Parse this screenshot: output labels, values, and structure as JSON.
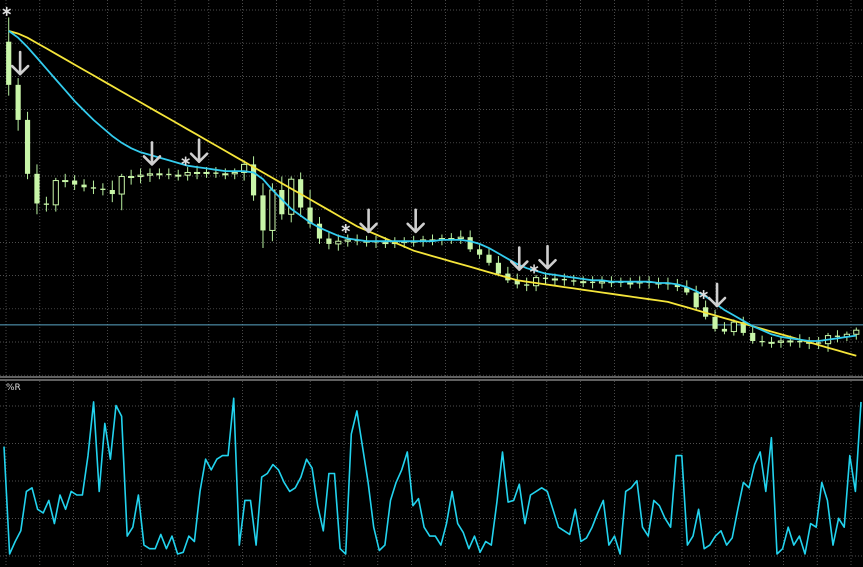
{
  "indicator_label": "%R",
  "colors": {
    "background": "#000000",
    "grid": "#c0c0c0",
    "frame": "#bfbfbf",
    "bull_candle": "#c8f5a8",
    "bear_candle": "#c8f5a8",
    "wick": "#b8f0a0",
    "ma_fast": "#33ccee",
    "ma_slow": "#f5e53a",
    "arrow": "#cfcfcf",
    "star": "#dddddd",
    "hline": "#5aa7c7",
    "wpr_line": "#22d3ee"
  },
  "chart_data": [
    {
      "type": "candlestick",
      "series": [
        {
          "name": "",
          "role": "price"
        },
        {
          "name": "",
          "role": "moving-average-fast"
        },
        {
          "name": "",
          "role": "moving-average-slow"
        }
      ],
      "candles": [
        {
          "o": 9.0,
          "h": 10.8,
          "l": 5.0,
          "c": 5.8
        },
        {
          "o": 5.8,
          "h": 6.3,
          "l": 2.4,
          "c": 3.2
        },
        {
          "o": 3.2,
          "h": 3.8,
          "l": -1.2,
          "c": -0.8
        },
        {
          "o": -0.8,
          "h": -0.1,
          "l": -3.8,
          "c": -3.0
        },
        {
          "o": -3.0,
          "h": -2.5,
          "l": -3.6,
          "c": -3.1
        },
        {
          "o": -3.1,
          "h": -1.1,
          "l": -3.6,
          "c": -1.3
        },
        {
          "o": -1.3,
          "h": -0.8,
          "l": -1.8,
          "c": -1.3
        },
        {
          "o": -1.3,
          "h": -0.9,
          "l": -2.0,
          "c": -1.6
        },
        {
          "o": -1.6,
          "h": -1.2,
          "l": -2.1,
          "c": -1.8
        },
        {
          "o": -1.8,
          "h": -1.3,
          "l": -2.3,
          "c": -1.9
        },
        {
          "o": -1.9,
          "h": -1.5,
          "l": -2.4,
          "c": -2.0
        },
        {
          "o": -2.0,
          "h": -1.3,
          "l": -2.9,
          "c": -2.3
        },
        {
          "o": -2.3,
          "h": -0.8,
          "l": -3.5,
          "c": -1.0
        },
        {
          "o": -1.0,
          "h": -0.5,
          "l": -1.6,
          "c": -1.0
        },
        {
          "o": -1.0,
          "h": -0.4,
          "l": -1.5,
          "c": -0.9
        },
        {
          "o": -0.9,
          "h": -0.4,
          "l": -1.4,
          "c": -0.8
        },
        {
          "o": -0.8,
          "h": -0.4,
          "l": -1.2,
          "c": -0.8
        },
        {
          "o": -0.8,
          "h": -0.4,
          "l": -1.2,
          "c": -0.9
        },
        {
          "o": -0.9,
          "h": -0.5,
          "l": -1.3,
          "c": -0.9
        },
        {
          "o": -0.9,
          "h": -0.3,
          "l": -1.3,
          "c": -0.7
        },
        {
          "o": -0.7,
          "h": -0.2,
          "l": -1.2,
          "c": -0.7
        },
        {
          "o": -0.7,
          "h": -0.3,
          "l": -1.1,
          "c": -0.7
        },
        {
          "o": -0.7,
          "h": -0.3,
          "l": -1.1,
          "c": -0.8
        },
        {
          "o": -0.8,
          "h": -0.4,
          "l": -1.2,
          "c": -0.8
        },
        {
          "o": -0.8,
          "h": -0.4,
          "l": -1.2,
          "c": -0.7
        },
        {
          "o": -0.7,
          "h": 0.2,
          "l": -1.3,
          "c": -0.1
        },
        {
          "o": -0.1,
          "h": 0.5,
          "l": -2.8,
          "c": -2.4
        },
        {
          "o": -2.4,
          "h": -1.5,
          "l": -6.3,
          "c": -5.0
        },
        {
          "o": -5.0,
          "h": -1.5,
          "l": -5.8,
          "c": -2.0
        },
        {
          "o": -2.0,
          "h": -1.0,
          "l": -4.2,
          "c": -3.8
        },
        {
          "o": -3.8,
          "h": -1.0,
          "l": -4.4,
          "c": -1.2
        },
        {
          "o": -1.2,
          "h": -0.7,
          "l": -4.0,
          "c": -3.3
        },
        {
          "o": -3.3,
          "h": -2.0,
          "l": -4.8,
          "c": -4.5
        },
        {
          "o": -4.5,
          "h": -4.0,
          "l": -6.0,
          "c": -5.6
        },
        {
          "o": -5.6,
          "h": -5.1,
          "l": -6.4,
          "c": -6.0
        },
        {
          "o": -6.0,
          "h": -5.3,
          "l": -6.5,
          "c": -5.8
        },
        {
          "o": -5.8,
          "h": -5.3,
          "l": -6.2,
          "c": -5.7
        },
        {
          "o": -5.7,
          "h": -5.3,
          "l": -6.1,
          "c": -5.8
        },
        {
          "o": -5.8,
          "h": -5.4,
          "l": -6.2,
          "c": -5.8
        },
        {
          "o": -5.8,
          "h": -5.4,
          "l": -6.3,
          "c": -5.9
        },
        {
          "o": -5.9,
          "h": -5.5,
          "l": -6.3,
          "c": -5.9
        },
        {
          "o": -5.9,
          "h": -5.5,
          "l": -6.3,
          "c": -5.9
        },
        {
          "o": -5.9,
          "h": -5.5,
          "l": -6.3,
          "c": -5.8
        },
        {
          "o": -5.8,
          "h": -5.4,
          "l": -6.2,
          "c": -5.8
        },
        {
          "o": -5.8,
          "h": -5.4,
          "l": -6.2,
          "c": -5.7
        },
        {
          "o": -5.7,
          "h": -5.3,
          "l": -6.1,
          "c": -5.7
        },
        {
          "o": -5.7,
          "h": -5.3,
          "l": -6.1,
          "c": -5.6
        },
        {
          "o": -5.6,
          "h": -5.2,
          "l": -6.0,
          "c": -5.6
        },
        {
          "o": -5.6,
          "h": -5.0,
          "l": -6.0,
          "c": -5.5
        },
        {
          "o": -5.5,
          "h": -5.0,
          "l": -6.6,
          "c": -6.4
        },
        {
          "o": -6.4,
          "h": -6.0,
          "l": -7.1,
          "c": -6.8
        },
        {
          "o": -6.8,
          "h": -6.3,
          "l": -7.6,
          "c": -7.4
        },
        {
          "o": -7.4,
          "h": -6.9,
          "l": -8.4,
          "c": -8.2
        },
        {
          "o": -8.2,
          "h": -7.7,
          "l": -8.9,
          "c": -8.7
        },
        {
          "o": -8.7,
          "h": -8.2,
          "l": -9.3,
          "c": -9.0
        },
        {
          "o": -9.0,
          "h": -8.5,
          "l": -9.5,
          "c": -9.1
        },
        {
          "o": -9.1,
          "h": -8.3,
          "l": -9.5,
          "c": -8.5
        },
        {
          "o": -8.5,
          "h": -8.1,
          "l": -9.0,
          "c": -8.6
        },
        {
          "o": -8.6,
          "h": -8.2,
          "l": -9.1,
          "c": -8.6
        },
        {
          "o": -8.6,
          "h": -8.2,
          "l": -9.1,
          "c": -8.7
        },
        {
          "o": -8.7,
          "h": -8.3,
          "l": -9.1,
          "c": -8.8
        },
        {
          "o": -8.8,
          "h": -8.4,
          "l": -9.2,
          "c": -8.8
        },
        {
          "o": -8.8,
          "h": -8.4,
          "l": -9.3,
          "c": -8.9
        },
        {
          "o": -8.9,
          "h": -8.4,
          "l": -9.3,
          "c": -8.8
        },
        {
          "o": -8.8,
          "h": -8.4,
          "l": -9.2,
          "c": -8.8
        },
        {
          "o": -8.8,
          "h": -8.5,
          "l": -9.2,
          "c": -8.9
        },
        {
          "o": -8.9,
          "h": -8.5,
          "l": -9.3,
          "c": -8.9
        },
        {
          "o": -8.9,
          "h": -8.4,
          "l": -9.3,
          "c": -8.8
        },
        {
          "o": -8.8,
          "h": -8.4,
          "l": -9.3,
          "c": -8.9
        },
        {
          "o": -8.9,
          "h": -8.5,
          "l": -9.3,
          "c": -8.9
        },
        {
          "o": -8.9,
          "h": -8.5,
          "l": -9.4,
          "c": -9.0
        },
        {
          "o": -9.0,
          "h": -8.6,
          "l": -9.5,
          "c": -9.2
        },
        {
          "o": -9.2,
          "h": -8.7,
          "l": -9.8,
          "c": -9.6
        },
        {
          "o": -9.6,
          "h": -9.1,
          "l": -10.9,
          "c": -10.7
        },
        {
          "o": -10.7,
          "h": -10.2,
          "l": -11.6,
          "c": -11.4
        },
        {
          "o": -11.4,
          "h": -10.9,
          "l": -12.5,
          "c": -12.3
        },
        {
          "o": -12.3,
          "h": -11.8,
          "l": -12.7,
          "c": -12.5
        },
        {
          "o": -12.5,
          "h": -11.6,
          "l": -12.8,
          "c": -11.8
        },
        {
          "o": -11.8,
          "h": -11.4,
          "l": -12.8,
          "c": -12.6
        },
        {
          "o": -12.6,
          "h": -12.1,
          "l": -13.4,
          "c": -13.2
        },
        {
          "o": -13.2,
          "h": -12.8,
          "l": -13.6,
          "c": -13.3
        },
        {
          "o": -13.3,
          "h": -12.9,
          "l": -13.7,
          "c": -13.3
        },
        {
          "o": -13.3,
          "h": -12.9,
          "l": -13.7,
          "c": -13.2
        },
        {
          "o": -13.2,
          "h": -12.8,
          "l": -13.6,
          "c": -13.2
        },
        {
          "o": -13.2,
          "h": -12.7,
          "l": -13.7,
          "c": -13.3
        },
        {
          "o": -13.3,
          "h": -12.9,
          "l": -13.8,
          "c": -13.3
        },
        {
          "o": -13.3,
          "h": -12.9,
          "l": -13.8,
          "c": -13.4
        },
        {
          "o": -13.4,
          "h": -12.6,
          "l": -14.0,
          "c": -12.8
        },
        {
          "o": -12.8,
          "h": -12.4,
          "l": -13.3,
          "c": -12.9
        },
        {
          "o": -12.9,
          "h": -12.5,
          "l": -13.2,
          "c": -12.7
        },
        {
          "o": -12.7,
          "h": -12.2,
          "l": -13.1,
          "c": -12.4
        }
      ],
      "ma_fast": [
        9.8,
        9.3,
        8.6,
        7.8,
        7.0,
        6.2,
        5.4,
        4.6,
        3.9,
        3.2,
        2.6,
        2.0,
        1.5,
        1.1,
        0.8,
        0.6,
        0.4,
        0.2,
        0.0,
        -0.2,
        -0.3,
        -0.4,
        -0.5,
        -0.6,
        -0.6,
        -0.6,
        -0.7,
        -1.2,
        -2.0,
        -2.7,
        -3.4,
        -3.9,
        -4.4,
        -4.8,
        -5.1,
        -5.4,
        -5.6,
        -5.7,
        -5.8,
        -5.8,
        -5.8,
        -5.8,
        -5.8,
        -5.8,
        -5.8,
        -5.8,
        -5.7,
        -5.7,
        -5.7,
        -5.8,
        -6.0,
        -6.3,
        -6.7,
        -7.1,
        -7.5,
        -7.8,
        -8.0,
        -8.2,
        -8.3,
        -8.4,
        -8.5,
        -8.6,
        -8.7,
        -8.7,
        -8.8,
        -8.8,
        -8.8,
        -8.8,
        -8.8,
        -8.9,
        -8.9,
        -9.0,
        -9.2,
        -9.5,
        -9.9,
        -10.4,
        -10.9,
        -11.3,
        -11.7,
        -12.1,
        -12.4,
        -12.7,
        -12.9,
        -13.0,
        -13.1,
        -13.2,
        -13.2,
        -13.1,
        -13.0,
        -12.9,
        -12.8
      ],
      "ma_slow": [
        9.8,
        9.6,
        9.3,
        8.9,
        8.5,
        8.1,
        7.7,
        7.3,
        6.9,
        6.5,
        6.1,
        5.7,
        5.3,
        4.9,
        4.5,
        4.1,
        3.7,
        3.3,
        2.9,
        2.5,
        2.1,
        1.7,
        1.3,
        0.9,
        0.5,
        0.1,
        -0.3,
        -0.7,
        -1.1,
        -1.5,
        -1.9,
        -2.3,
        -2.7,
        -3.1,
        -3.5,
        -3.9,
        -4.3,
        -4.7,
        -5.0,
        -5.3,
        -5.6,
        -5.9,
        -6.2,
        -6.5,
        -6.7,
        -6.9,
        -7.1,
        -7.3,
        -7.5,
        -7.7,
        -7.9,
        -8.1,
        -8.3,
        -8.5,
        -8.7,
        -8.8,
        -8.9,
        -9.0,
        -9.1,
        -9.2,
        -9.3,
        -9.4,
        -9.5,
        -9.6,
        -9.7,
        -9.8,
        -9.9,
        -10.0,
        -10.1,
        -10.2,
        -10.3,
        -10.5,
        -10.7,
        -10.9,
        -11.1,
        -11.3,
        -11.5,
        -11.7,
        -11.9,
        -12.1,
        -12.3,
        -12.5,
        -12.7,
        -12.9,
        -13.1,
        -13.3,
        -13.5,
        -13.7,
        -13.9,
        -14.1,
        -14.3
      ],
      "down_arrows": [
        1,
        15,
        20,
        38,
        43,
        54,
        57,
        75
      ],
      "stars": [
        0,
        19,
        36,
        56,
        74
      ],
      "horizontal_line": -12.0,
      "ylim": [
        -15.5,
        11.5
      ],
      "grid": true
    },
    {
      "type": "line",
      "series": [
        {
          "name": "%R",
          "values": [
            -35,
            -95,
            -88,
            -82,
            -60,
            -58,
            -70,
            -72,
            -65,
            -78,
            -62,
            -70,
            -60,
            -62,
            -62,
            -40,
            -10,
            -60,
            -22,
            -42,
            -12,
            -18,
            -85,
            -80,
            -62,
            -90,
            -92,
            -92,
            -84,
            -92,
            -85,
            -95,
            -94,
            -85,
            -88,
            -60,
            -42,
            -48,
            -42,
            -40,
            -40,
            -8,
            -90,
            -65,
            -65,
            -90,
            -52,
            -50,
            -45,
            -48,
            -55,
            -60,
            -58,
            -52,
            -42,
            -47,
            -68,
            -82,
            -50,
            -50,
            -92,
            -95,
            -28,
            -15,
            -35,
            -55,
            -80,
            -93,
            -90,
            -65,
            -55,
            -48,
            -38,
            -68,
            -64,
            -80,
            -85,
            -85,
            -90,
            -78,
            -60,
            -78,
            -83,
            -92,
            -85,
            -94,
            -88,
            -90,
            -66,
            -38,
            -66,
            -65,
            -56,
            -78,
            -62,
            -60,
            -58,
            -60,
            -70,
            -80,
            -82,
            -84,
            -70,
            -88,
            -86,
            -80,
            -72,
            -65,
            -90,
            -85,
            -95,
            -60,
            -58,
            -54,
            -80,
            -85,
            -65,
            -68,
            -75,
            -80,
            -40,
            -40,
            -90,
            -85,
            -70,
            -92,
            -90,
            -85,
            -82,
            -90,
            -86,
            -70,
            -55,
            -58,
            -45,
            -38,
            -60,
            -30,
            -95,
            -92,
            -80,
            -90,
            -85,
            -95,
            -78,
            -80,
            -55,
            -65,
            -90,
            -75,
            -80,
            -40,
            -60,
            -10
          ]
        }
      ],
      "ylim": [
        -100,
        0
      ],
      "grid": true
    }
  ]
}
